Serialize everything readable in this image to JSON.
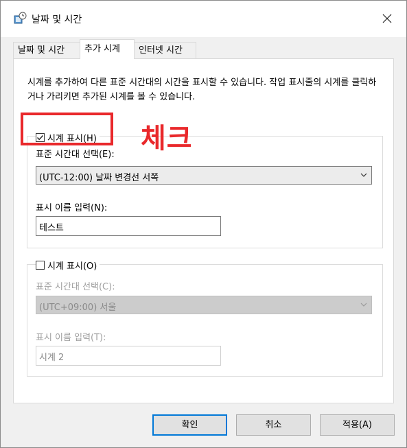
{
  "window": {
    "title": "날짜 및 시간"
  },
  "tabs": [
    {
      "label": "날짜 및 시간"
    },
    {
      "label": "추가 시계"
    },
    {
      "label": "인터넷 시간"
    }
  ],
  "description": "시계를 추가하여 다른 표준 시간대의 시간을 표시할 수 있습니다. 작업 표시줄의 시계를 클릭하거나 가리키면 추가된 시계를 볼 수 있습니다.",
  "clock1": {
    "checkbox_label": "시계 표시(H)",
    "checked": true,
    "timezone_label": "표준 시간대 선택(E):",
    "timezone_value": "(UTC-12:00) 날짜 변경선 서쪽",
    "name_label": "표시 이름 입력(N):",
    "name_value": "테스트"
  },
  "clock2": {
    "checkbox_label": "시계 표시(O)",
    "checked": false,
    "timezone_label": "표준 시간대 선택(C):",
    "timezone_value": "(UTC+09:00) 서울",
    "name_label": "표시 이름 입력(T):",
    "name_value": "시계 2"
  },
  "annotation": {
    "text": "체크",
    "color": "#e9282b"
  },
  "buttons": {
    "ok": "확인",
    "cancel": "취소",
    "apply": "적용(A)"
  },
  "colors": {
    "accent": "#0078d7",
    "highlight": "#e9282b"
  }
}
